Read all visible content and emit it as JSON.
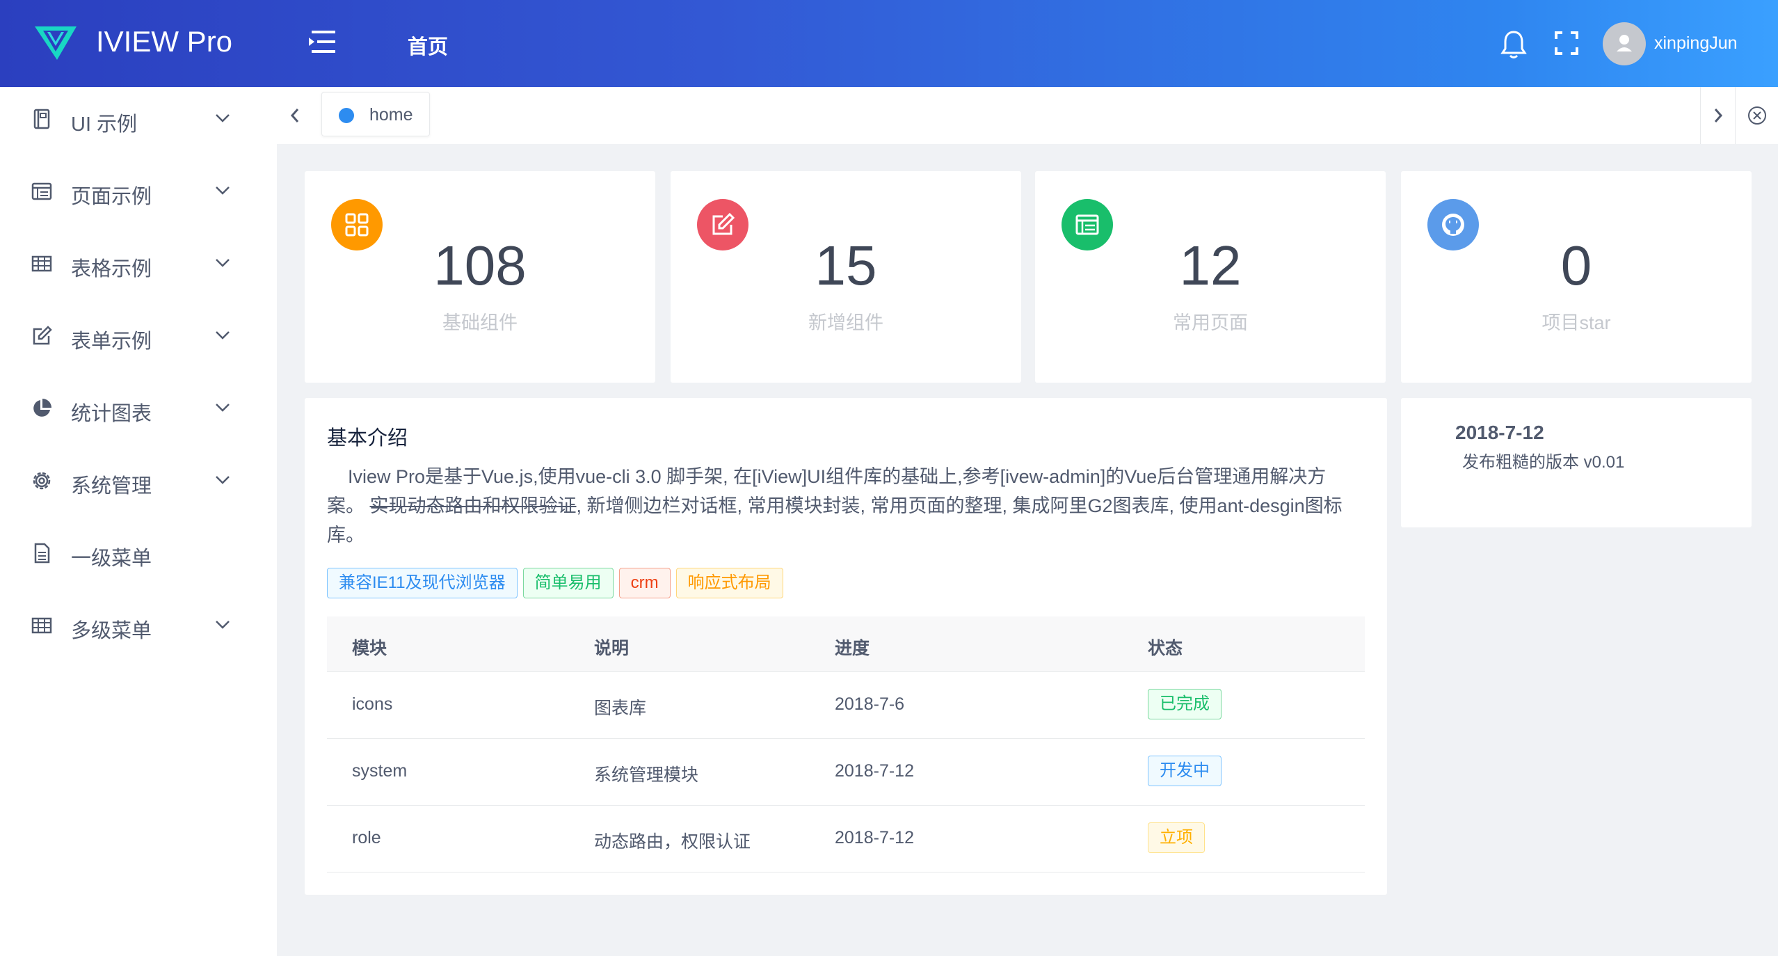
{
  "header": {
    "brand": "IVIEW Pro",
    "home_link": "首页",
    "username": "xinpingJun",
    "brand_color": "#3358d4"
  },
  "sidebar": {
    "items": [
      {
        "label": "UI 示例",
        "icon": "book-icon",
        "has_children": true
      },
      {
        "label": "页面示例",
        "icon": "browser-icon",
        "has_children": true
      },
      {
        "label": "表格示例",
        "icon": "table-icon",
        "has_children": true
      },
      {
        "label": "表单示例",
        "icon": "edit-icon",
        "has_children": true
      },
      {
        "label": "统计图表",
        "icon": "pie-chart-icon",
        "has_children": true
      },
      {
        "label": "系统管理",
        "icon": "gear-icon",
        "has_children": true
      },
      {
        "label": "一级菜单",
        "icon": "document-icon",
        "has_children": false
      },
      {
        "label": "多级菜单",
        "icon": "table-icon",
        "has_children": true
      }
    ]
  },
  "tabs": {
    "items": [
      {
        "label": "home",
        "active": true
      }
    ]
  },
  "stats": [
    {
      "value": "108",
      "label": "基础组件",
      "icon": "grid-icon",
      "color": "#ff9900"
    },
    {
      "value": "15",
      "label": "新增组件",
      "icon": "edit-icon",
      "color": "#ed5565"
    },
    {
      "value": "12",
      "label": "常用页面",
      "icon": "browser-icon",
      "color": "#19be6b"
    },
    {
      "value": "0",
      "label": "项目star",
      "icon": "github-icon",
      "color": "#5b9bea"
    }
  ],
  "intro": {
    "title": "基本介绍",
    "text_before": "Iview Pro是基于Vue.js,使用vue-cli 3.0 脚手架, 在[iView]UI组件库的基础上,参考[ivew-admin]的Vue后台管理通用解决方案。 ",
    "text_strike": "实现动态路由和权限验证",
    "text_after": ", 新增侧边栏对话框, 常用模块封装, 常用页面的整理, 集成阿里G2图表库, 使用ant-desgin图标库。",
    "tags": [
      {
        "label": "兼容IE11及现代浏览器",
        "color": "blue"
      },
      {
        "label": "简单易用",
        "color": "green"
      },
      {
        "label": "crm",
        "color": "red"
      },
      {
        "label": "响应式布局",
        "color": "yellow"
      }
    ]
  },
  "table": {
    "headers": [
      "模块",
      "说明",
      "进度",
      "状态"
    ],
    "rows": [
      {
        "module": "icons",
        "desc": "图表库",
        "progress": "2018-7-6",
        "status": "已完成",
        "status_color": "green"
      },
      {
        "module": "system",
        "desc": "系统管理模块",
        "progress": "2018-7-12",
        "status": "开发中",
        "status_color": "blue"
      },
      {
        "module": "role",
        "desc": "动态路由，权限认证",
        "progress": "2018-7-12",
        "status": "立项",
        "status_color": "yellow"
      }
    ]
  },
  "changelog": {
    "date": "2018-7-12",
    "desc": "发布粗糙的版本 v0.01"
  }
}
